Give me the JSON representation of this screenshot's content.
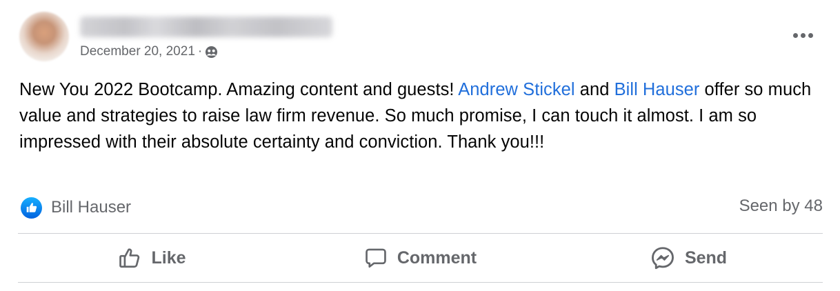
{
  "post": {
    "date": "December 20, 2021",
    "separator": "·",
    "audience_icon": "friends-audience-icon",
    "more_icon": "more-options-icon",
    "text_parts": {
      "intro": "New You 2022 Bootcamp. Amazing content and guests! ",
      "mention1": "Andrew Stickel",
      "and": " and ",
      "mention2": "Bill Hauser",
      "rest": " offer so much value and strategies to raise law firm revenue. So much promise, I can touch it almost. I am so impressed with their absolute certainty and conviction. Thank you!!!"
    },
    "colors": {
      "mention": "#216fdb",
      "secondary_text": "#65676b",
      "divider": "#ced0d4"
    }
  },
  "reactions": {
    "icon": "like-reaction-icon",
    "reactor": "Bill Hauser",
    "seen_by": "Seen by 48"
  },
  "actions": [
    {
      "label": "Like",
      "icon": "thumbs-up-icon"
    },
    {
      "label": "Comment",
      "icon": "comment-icon"
    },
    {
      "label": "Send",
      "icon": "messenger-icon"
    }
  ]
}
